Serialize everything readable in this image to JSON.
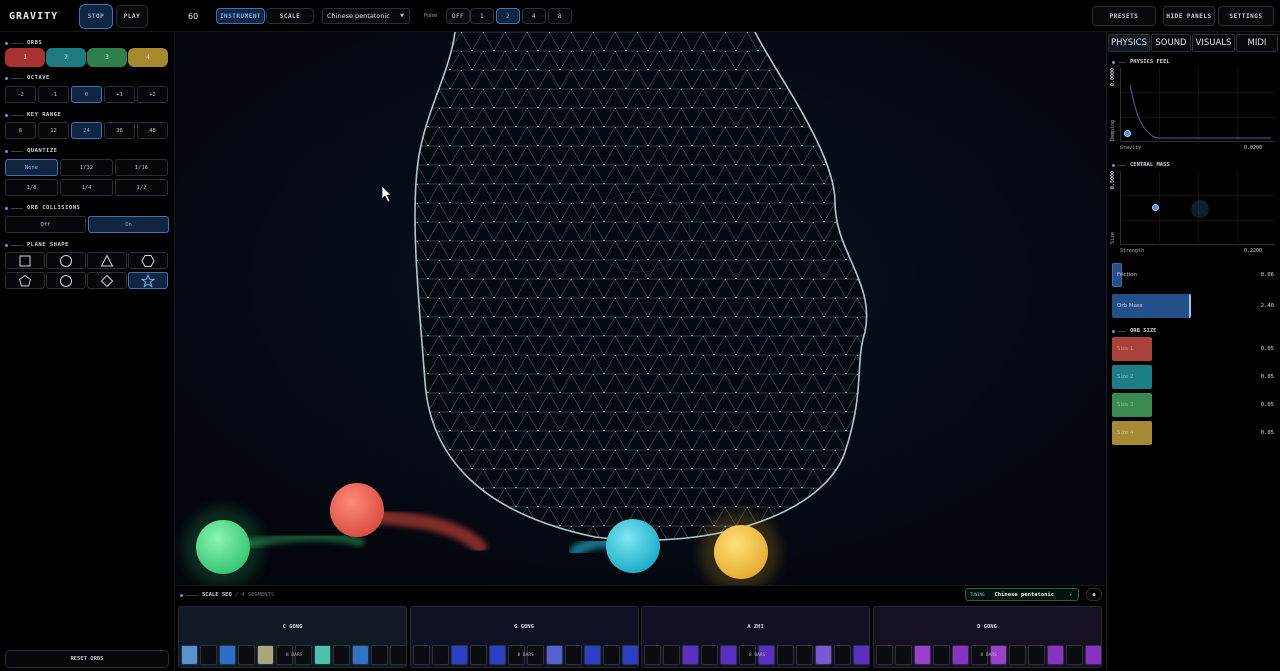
{
  "app": {
    "title": "GRAVITY"
  },
  "transport": {
    "stop_label": "STOP",
    "play_label": "PLAY",
    "tempo": "60"
  },
  "mode_tabs": {
    "instrument": "INSTRUMENT",
    "scale": "SCALE"
  },
  "scale_select": {
    "value": "Chinese pentatonic"
  },
  "pulse": {
    "label": "Pulse",
    "options": [
      "OFF",
      "1",
      "2",
      "4",
      "8"
    ],
    "selected": "2"
  },
  "top_right": {
    "presets": "PRESETS",
    "hide_panels": "HIDE PANELS",
    "settings": "SETTINGS"
  },
  "left": {
    "orbs": {
      "title": "ORBS",
      "items": [
        {
          "label": "1",
          "color": "#a8322f"
        },
        {
          "label": "2",
          "color": "#1c7a80"
        },
        {
          "label": "3",
          "color": "#2f7f4a"
        },
        {
          "label": "4",
          "color": "#a6882e"
        }
      ]
    },
    "octave": {
      "title": "OCTAVE",
      "options": [
        "-2",
        "-1",
        "0",
        "+1",
        "+2"
      ],
      "selected": "0"
    },
    "key_range": {
      "title": "KEY RANGE",
      "options": [
        "6",
        "12",
        "24",
        "36",
        "48"
      ],
      "selected": "24"
    },
    "quantize": {
      "title": "QUANTIZE",
      "row1": [
        "None",
        "1/32",
        "1/16"
      ],
      "row2": [
        "1/8",
        "1/4",
        "1/2"
      ],
      "selected": "None"
    },
    "collisions": {
      "title": "ORB COLLISIONS",
      "options": [
        "Off",
        "On"
      ],
      "selected": "On"
    },
    "plane_shape": {
      "title": "PLANE SHAPE",
      "row1": [
        "square-icon",
        "circle-icon",
        "triangle-icon",
        "hexagon-icon"
      ],
      "row2": [
        "pentagon-icon",
        "circle-icon",
        "diamond-icon",
        "star-icon"
      ],
      "selected": "star-icon"
    },
    "reset_label": "RESET ORBS"
  },
  "canvas": {
    "orbs": [
      {
        "name": "orb-green",
        "color": "#4fe08a"
      },
      {
        "name": "orb-red",
        "color": "#ea5a4c"
      },
      {
        "name": "orb-cyan",
        "color": "#22c6dc"
      },
      {
        "name": "orb-yellow",
        "color": "#f2c244"
      }
    ]
  },
  "sequencer": {
    "title": "SCALE SEQ",
    "segments_count": "4 SEGMENTS",
    "tuning_label": "TUNING",
    "tuning_value": "Chinese pentatonic",
    "segments": [
      {
        "label": "C GONG",
        "bars": "8 BARS",
        "tint": "#0f1a24",
        "steps": [
          "#5b8fd0",
          "#0a0c10",
          "#2a6fc8",
          "#0a0c10",
          "#a9a878",
          "#0a0c10",
          "#0a0c10",
          "#4fc0a8",
          "#0a0c10",
          "#2f72c8",
          "#0a0c10",
          "#0a0c10"
        ]
      },
      {
        "label": "G GONG",
        "bars": "8 BARS",
        "tint": "#0e1224",
        "steps": [
          "#0a0c10",
          "#0a0c10",
          "#2d3fc4",
          "#0a0c10",
          "#2d3fc4",
          "#0a0c10",
          "#0a0c10",
          "#5860d0",
          "#0a0c10",
          "#2d3fc4",
          "#0a0c10",
          "#2d3fc4"
        ]
      },
      {
        "label": "A ZHI",
        "bars": "8 BARS",
        "tint": "#130f24",
        "steps": [
          "#0a0c10",
          "#0a0c10",
          "#5a2fc4",
          "#0a0c10",
          "#5a2fc4",
          "#0a0c10",
          "#5a2fc4",
          "#0a0c10",
          "#0a0c10",
          "#7a58d2",
          "#0a0c10",
          "#5a2fc4"
        ]
      },
      {
        "label": "D GONG",
        "bars": "8 BARS",
        "tint": "#170f22",
        "steps": [
          "#0a0c10",
          "#0a0c10",
          "#9a40cc",
          "#0a0c10",
          "#8a30c4",
          "#0a0c10",
          "#9a40cc",
          "#0a0c10",
          "#0a0c10",
          "#8a30c4",
          "#0a0c10",
          "#8a30c4"
        ]
      }
    ]
  },
  "right": {
    "tabs": [
      "PHYSICS",
      "SOUND",
      "VISUALS",
      "MIDI"
    ],
    "active_tab": "PHYSICS",
    "physics_feel": {
      "title": "PHYSICS FEEL",
      "y_label": "Damping",
      "y_value": "0.0000",
      "x_label": "Gravity",
      "x_value": "0.0200"
    },
    "central_mass": {
      "title": "CENTRAL MASS",
      "y_label": "Size",
      "y_value": "0.5000",
      "x_label": "Strength",
      "x_value": "0.2200"
    },
    "friction": {
      "label": "Friction",
      "value": "0.06",
      "level": 0.06
    },
    "orb_mass": {
      "label": "Orb Mass",
      "value": "2.40",
      "level": 0.48
    },
    "orb_size": {
      "title": "ORB SIZE",
      "items": [
        {
          "label": "Size 1",
          "value": "0.05",
          "color": "#a8413a"
        },
        {
          "label": "Size 2",
          "value": "0.05",
          "color": "#1c7e86"
        },
        {
          "label": "Size 3",
          "value": "0.05",
          "color": "#3a8a52"
        },
        {
          "label": "Size 4",
          "value": "0.05",
          "color": "#a68a34"
        }
      ]
    }
  }
}
